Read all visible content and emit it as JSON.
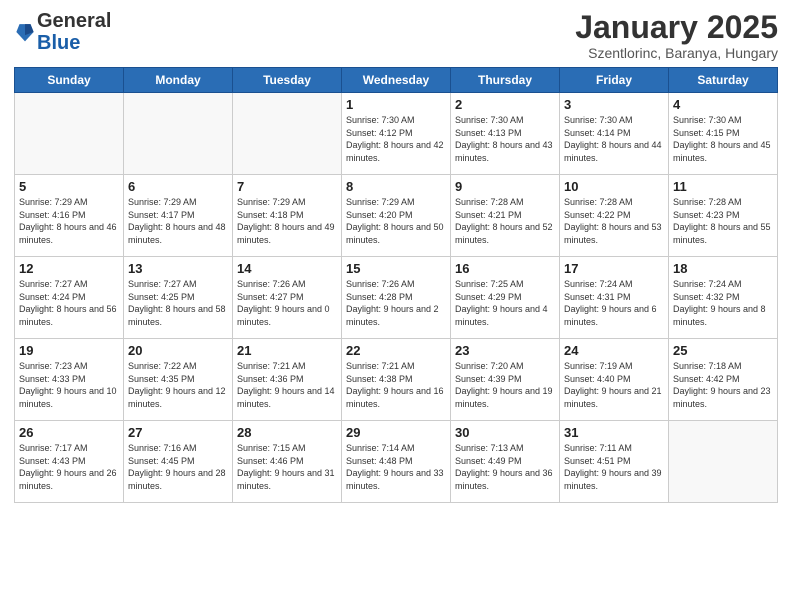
{
  "header": {
    "logo_general": "General",
    "logo_blue": "Blue",
    "title": "January 2025",
    "subtitle": "Szentlorinc, Baranya, Hungary"
  },
  "weekdays": [
    "Sunday",
    "Monday",
    "Tuesday",
    "Wednesday",
    "Thursday",
    "Friday",
    "Saturday"
  ],
  "weeks": [
    [
      {
        "day": "",
        "info": ""
      },
      {
        "day": "",
        "info": ""
      },
      {
        "day": "",
        "info": ""
      },
      {
        "day": "1",
        "info": "Sunrise: 7:30 AM\nSunset: 4:12 PM\nDaylight: 8 hours and 42 minutes."
      },
      {
        "day": "2",
        "info": "Sunrise: 7:30 AM\nSunset: 4:13 PM\nDaylight: 8 hours and 43 minutes."
      },
      {
        "day": "3",
        "info": "Sunrise: 7:30 AM\nSunset: 4:14 PM\nDaylight: 8 hours and 44 minutes."
      },
      {
        "day": "4",
        "info": "Sunrise: 7:30 AM\nSunset: 4:15 PM\nDaylight: 8 hours and 45 minutes."
      }
    ],
    [
      {
        "day": "5",
        "info": "Sunrise: 7:29 AM\nSunset: 4:16 PM\nDaylight: 8 hours and 46 minutes."
      },
      {
        "day": "6",
        "info": "Sunrise: 7:29 AM\nSunset: 4:17 PM\nDaylight: 8 hours and 48 minutes."
      },
      {
        "day": "7",
        "info": "Sunrise: 7:29 AM\nSunset: 4:18 PM\nDaylight: 8 hours and 49 minutes."
      },
      {
        "day": "8",
        "info": "Sunrise: 7:29 AM\nSunset: 4:20 PM\nDaylight: 8 hours and 50 minutes."
      },
      {
        "day": "9",
        "info": "Sunrise: 7:28 AM\nSunset: 4:21 PM\nDaylight: 8 hours and 52 minutes."
      },
      {
        "day": "10",
        "info": "Sunrise: 7:28 AM\nSunset: 4:22 PM\nDaylight: 8 hours and 53 minutes."
      },
      {
        "day": "11",
        "info": "Sunrise: 7:28 AM\nSunset: 4:23 PM\nDaylight: 8 hours and 55 minutes."
      }
    ],
    [
      {
        "day": "12",
        "info": "Sunrise: 7:27 AM\nSunset: 4:24 PM\nDaylight: 8 hours and 56 minutes."
      },
      {
        "day": "13",
        "info": "Sunrise: 7:27 AM\nSunset: 4:25 PM\nDaylight: 8 hours and 58 minutes."
      },
      {
        "day": "14",
        "info": "Sunrise: 7:26 AM\nSunset: 4:27 PM\nDaylight: 9 hours and 0 minutes."
      },
      {
        "day": "15",
        "info": "Sunrise: 7:26 AM\nSunset: 4:28 PM\nDaylight: 9 hours and 2 minutes."
      },
      {
        "day": "16",
        "info": "Sunrise: 7:25 AM\nSunset: 4:29 PM\nDaylight: 9 hours and 4 minutes."
      },
      {
        "day": "17",
        "info": "Sunrise: 7:24 AM\nSunset: 4:31 PM\nDaylight: 9 hours and 6 minutes."
      },
      {
        "day": "18",
        "info": "Sunrise: 7:24 AM\nSunset: 4:32 PM\nDaylight: 9 hours and 8 minutes."
      }
    ],
    [
      {
        "day": "19",
        "info": "Sunrise: 7:23 AM\nSunset: 4:33 PM\nDaylight: 9 hours and 10 minutes."
      },
      {
        "day": "20",
        "info": "Sunrise: 7:22 AM\nSunset: 4:35 PM\nDaylight: 9 hours and 12 minutes."
      },
      {
        "day": "21",
        "info": "Sunrise: 7:21 AM\nSunset: 4:36 PM\nDaylight: 9 hours and 14 minutes."
      },
      {
        "day": "22",
        "info": "Sunrise: 7:21 AM\nSunset: 4:38 PM\nDaylight: 9 hours and 16 minutes."
      },
      {
        "day": "23",
        "info": "Sunrise: 7:20 AM\nSunset: 4:39 PM\nDaylight: 9 hours and 19 minutes."
      },
      {
        "day": "24",
        "info": "Sunrise: 7:19 AM\nSunset: 4:40 PM\nDaylight: 9 hours and 21 minutes."
      },
      {
        "day": "25",
        "info": "Sunrise: 7:18 AM\nSunset: 4:42 PM\nDaylight: 9 hours and 23 minutes."
      }
    ],
    [
      {
        "day": "26",
        "info": "Sunrise: 7:17 AM\nSunset: 4:43 PM\nDaylight: 9 hours and 26 minutes."
      },
      {
        "day": "27",
        "info": "Sunrise: 7:16 AM\nSunset: 4:45 PM\nDaylight: 9 hours and 28 minutes."
      },
      {
        "day": "28",
        "info": "Sunrise: 7:15 AM\nSunset: 4:46 PM\nDaylight: 9 hours and 31 minutes."
      },
      {
        "day": "29",
        "info": "Sunrise: 7:14 AM\nSunset: 4:48 PM\nDaylight: 9 hours and 33 minutes."
      },
      {
        "day": "30",
        "info": "Sunrise: 7:13 AM\nSunset: 4:49 PM\nDaylight: 9 hours and 36 minutes."
      },
      {
        "day": "31",
        "info": "Sunrise: 7:11 AM\nSunset: 4:51 PM\nDaylight: 9 hours and 39 minutes."
      },
      {
        "day": "",
        "info": ""
      }
    ]
  ]
}
